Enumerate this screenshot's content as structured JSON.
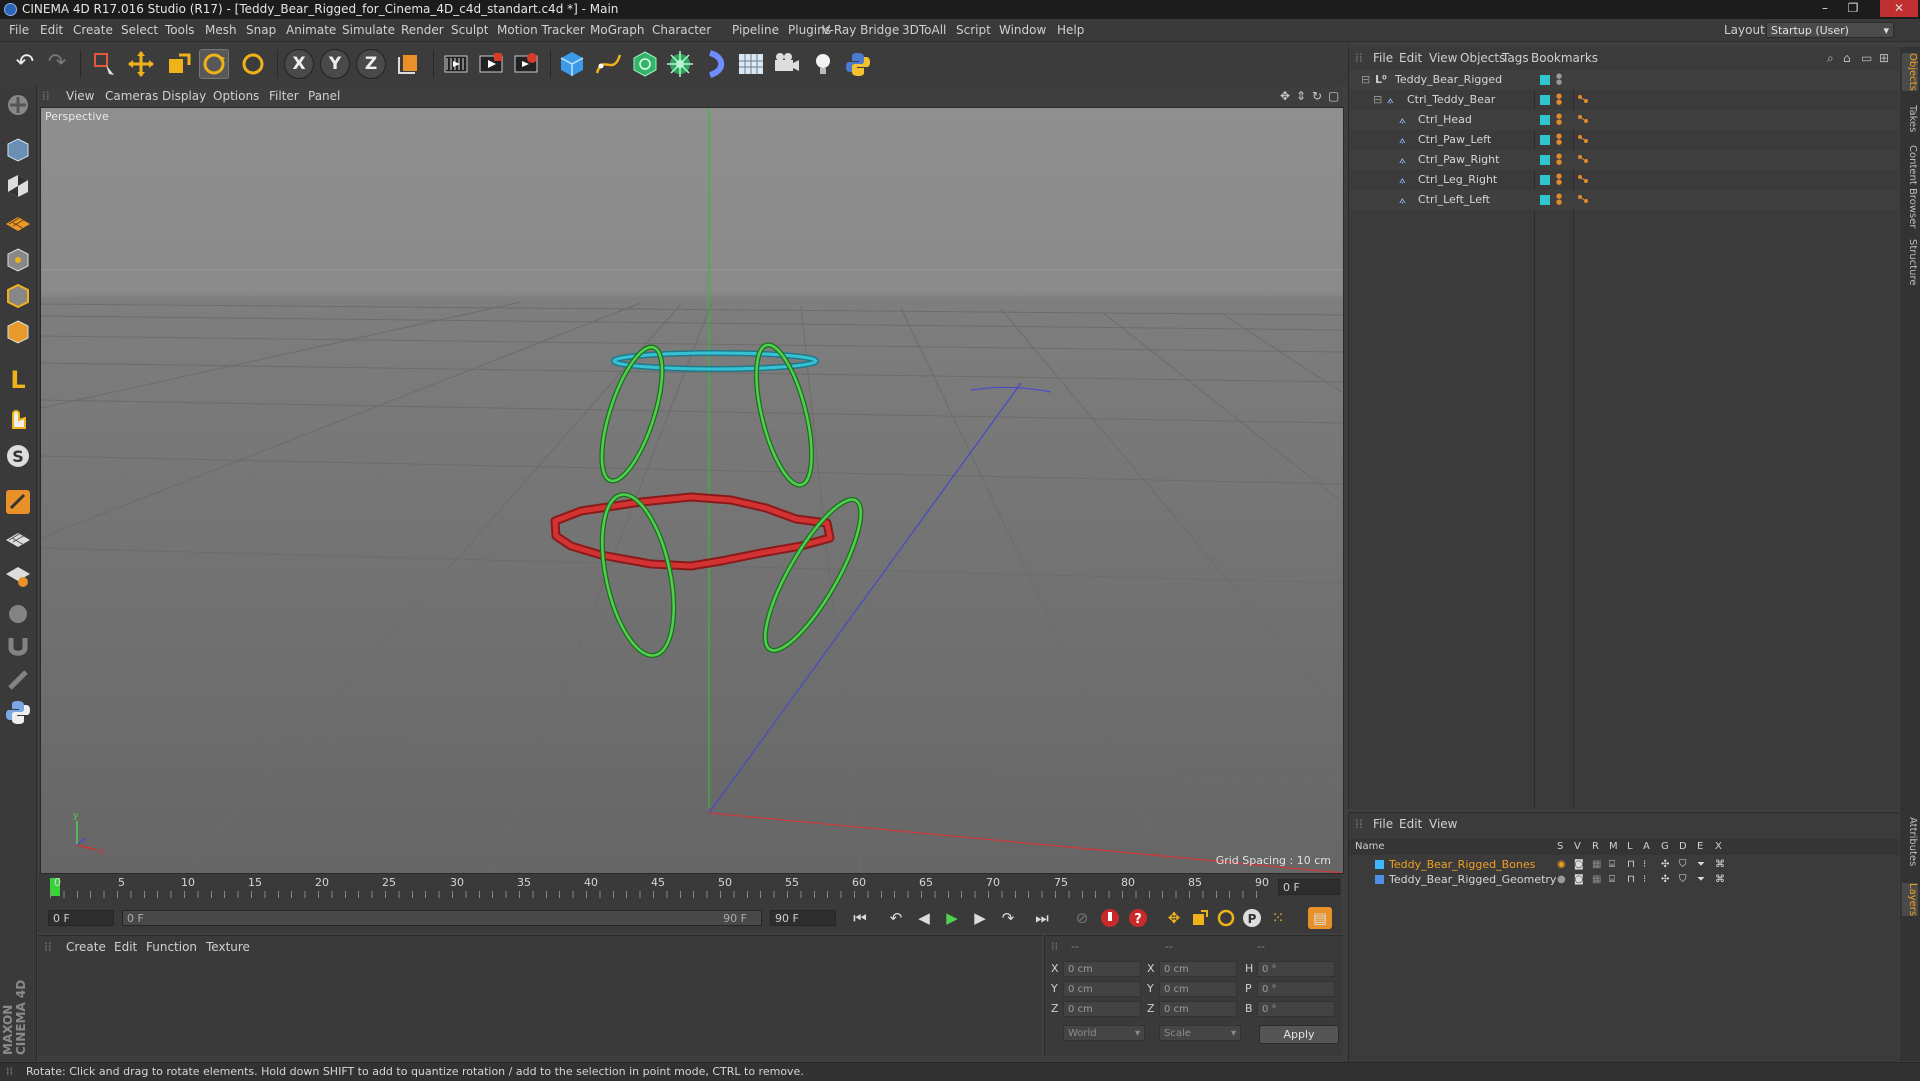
{
  "window": {
    "title": "CINEMA 4D R17.016 Studio (R17) - [Teddy_Bear_Rigged_for_Cinema_4D_c4d_standart.c4d *] - Main"
  },
  "menubar": {
    "items": [
      "File",
      "Edit",
      "Create",
      "Select",
      "Tools",
      "Mesh",
      "Snap",
      "Animate",
      "Simulate",
      "Render",
      "Sculpt",
      "Motion Tracker",
      "MoGraph",
      "Character",
      "Pipeline",
      "Plugins",
      "V-Ray Bridge",
      "3DToAll",
      "Script",
      "Window",
      "Help"
    ],
    "layout_label": "Layout:",
    "layout_value": "Startup (User)"
  },
  "viewport": {
    "menu": [
      "View",
      "Cameras",
      "Display",
      "Options",
      "Filter",
      "Panel"
    ],
    "camera_label": "Perspective",
    "grid_spacing": "Grid Spacing : 10 cm"
  },
  "timeline": {
    "ticks": [
      "0",
      "5",
      "10",
      "15",
      "20",
      "25",
      "30",
      "35",
      "40",
      "45",
      "50",
      "55",
      "60",
      "65",
      "70",
      "75",
      "80",
      "85",
      "90"
    ],
    "current_frame": "0 F",
    "start_field": "0 F",
    "range_start": "0 F",
    "range_end": "90 F",
    "end_field": "90 F"
  },
  "material_panel": {
    "menu": [
      "Create",
      "Edit",
      "Function",
      "Texture"
    ]
  },
  "coords": {
    "headers": [
      "--",
      "--",
      "--"
    ],
    "rows": [
      {
        "a": "X",
        "av": "0 cm",
        "b": "X",
        "bv": "0 cm",
        "c": "H",
        "cv": "0 °"
      },
      {
        "a": "Y",
        "av": "0 cm",
        "b": "Y",
        "bv": "0 cm",
        "c": "P",
        "cv": "0 °"
      },
      {
        "a": "Z",
        "av": "0 cm",
        "b": "Z",
        "bv": "0 cm",
        "c": "B",
        "cv": "0 °"
      }
    ],
    "mode1": "World",
    "mode2": "Scale",
    "apply": "Apply"
  },
  "object_manager": {
    "menu": [
      "File",
      "Edit",
      "View",
      "Objects",
      "Tags",
      "Bookmarks"
    ],
    "objects": [
      {
        "name": "Teddy_Bear_Rigged",
        "indent": 0
      },
      {
        "name": "Ctrl_Teddy_Bear",
        "indent": 1
      },
      {
        "name": "Ctrl_Head",
        "indent": 2
      },
      {
        "name": "Ctrl_Paw_Left",
        "indent": 2
      },
      {
        "name": "Ctrl_Paw_Right",
        "indent": 2
      },
      {
        "name": "Ctrl_Leg_Right",
        "indent": 2
      },
      {
        "name": "Ctrl_Left_Left",
        "indent": 2
      }
    ]
  },
  "layer_manager": {
    "menu": [
      "File",
      "Edit",
      "View"
    ],
    "columns": [
      "Name",
      "S",
      "V",
      "R",
      "M",
      "L",
      "A",
      "G",
      "D",
      "E",
      "X"
    ],
    "layers": [
      {
        "name": "Teddy_Bear_Rigged_Bones",
        "color": "#3fb7ff"
      },
      {
        "name": "Teddy_Bear_Rigged_Geometry",
        "color": "#4f8fe6"
      }
    ]
  },
  "right_tabs": [
    "Objects",
    "Takes",
    "Content Browser",
    "Structure",
    "Attributes",
    "Layers"
  ],
  "brand": "MAXON CINEMA 4D",
  "status": "Rotate: Click and drag to rotate elements. Hold down SHIFT to add to quantize rotation / add to the selection in point mode, CTRL to remove."
}
